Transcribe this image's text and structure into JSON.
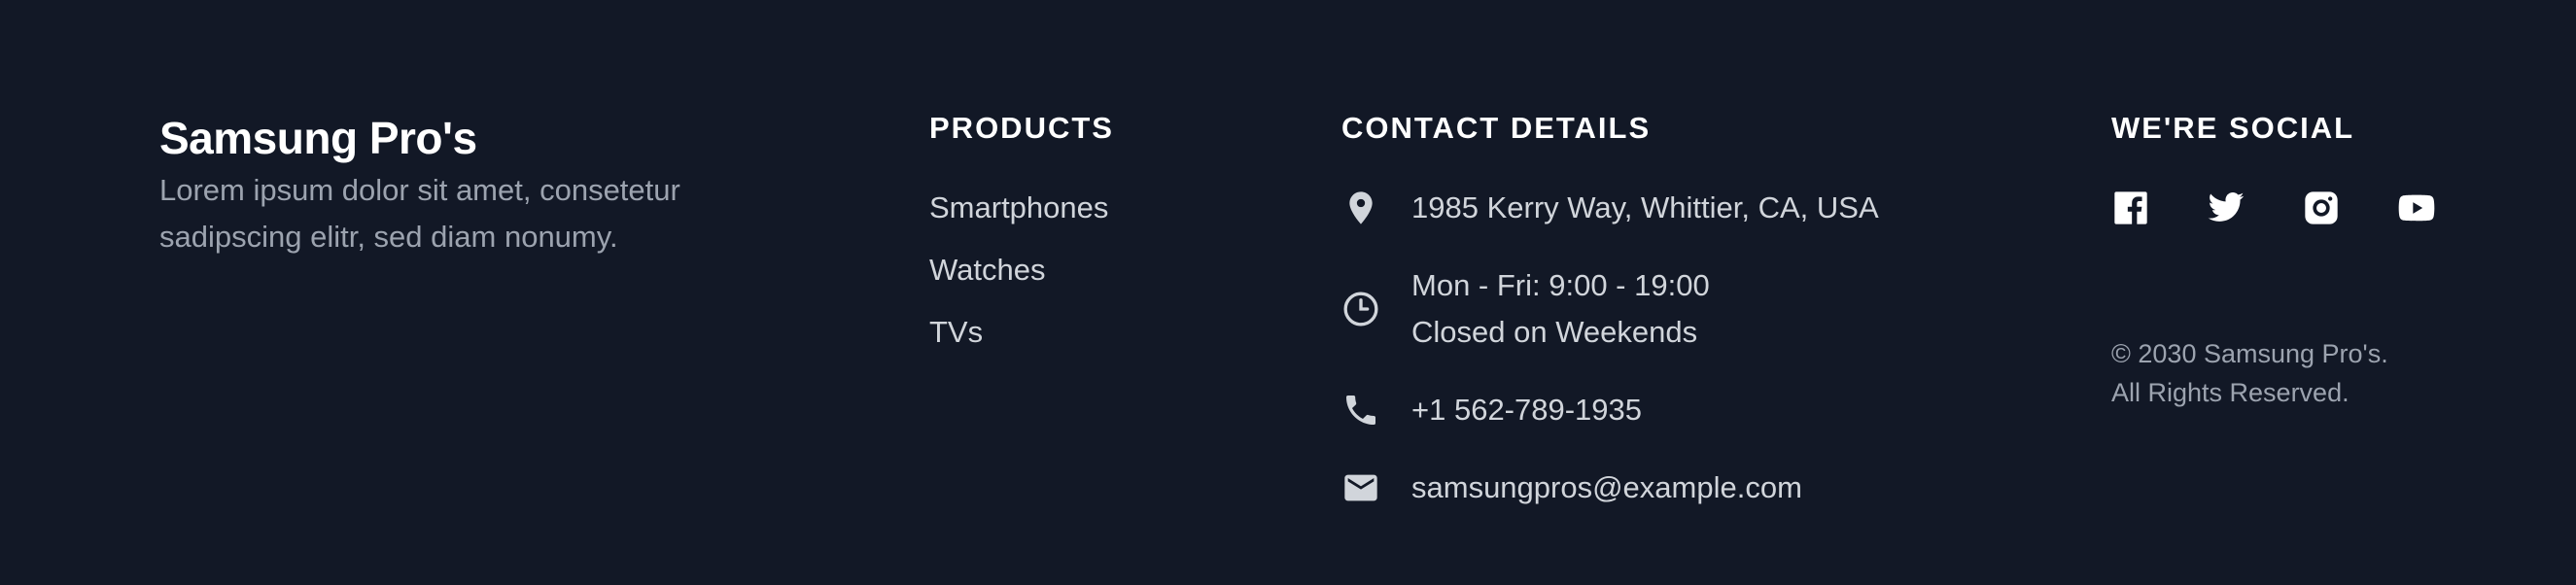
{
  "brand": {
    "title": "Samsung Pro's",
    "description": "Lorem ipsum dolor sit amet, consetetur sadipscing elitr, sed diam nonumy."
  },
  "products": {
    "heading": "PRODUCTS",
    "items": [
      {
        "label": "Smartphones"
      },
      {
        "label": "Watches"
      },
      {
        "label": "TVs"
      }
    ]
  },
  "contact": {
    "heading": "CONTACT DETAILS",
    "address": {
      "icon": "map-pin-icon",
      "text": "1985 Kerry Way, Whittier, CA, USA"
    },
    "hours": {
      "icon": "clock-icon",
      "line1": "Mon - Fri: 9:00 - 19:00",
      "line2": "Closed on Weekends"
    },
    "phone": {
      "icon": "phone-icon",
      "text": "+1 562-789-1935"
    },
    "email": {
      "icon": "mail-icon",
      "text": "samsungpros@example.com"
    }
  },
  "social": {
    "heading": "WE'RE SOCIAL",
    "icons": [
      "facebook-icon",
      "twitter-icon",
      "instagram-icon",
      "youtube-icon"
    ],
    "copyright_line1": "© 2030 Samsung Pro's.",
    "copyright_line2": "All Rights Reserved."
  },
  "colors": {
    "background": "#121826",
    "heading": "#ffffff",
    "body_text": "#d1d5db",
    "muted_text": "#9ca3af"
  }
}
